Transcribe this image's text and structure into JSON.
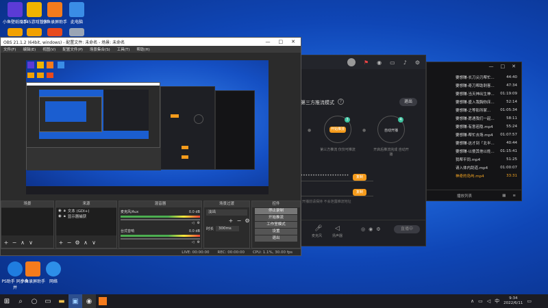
{
  "desktop": {
    "icons": [
      {
        "label": "小鱼壁纸助手",
        "color": "#5b3bd6"
      },
      {
        "label": "2345游戏管家",
        "color": "#f0b400"
      },
      {
        "label": "小鱼录屏助手",
        "color": "#f57b1c"
      },
      {
        "label": "此电脑",
        "color": "#3a8de6"
      },
      {
        "label": "",
        "color": "#f2a100"
      },
      {
        "label": "",
        "color": "#f2a100"
      },
      {
        "label": "",
        "color": "#e84a1c"
      },
      {
        "label": "",
        "color": "#9aa5b5"
      },
      {
        "label": "PS助手 同步合并",
        "color": "#1f7de0"
      },
      {
        "label": "小鱼录屏助手",
        "color": "#f57b1c"
      },
      {
        "label": "网络",
        "color": "#2d8fe8"
      }
    ]
  },
  "obs": {
    "title": "OBS 21.1.2 (64bit, windows) - 配置文件: 未命名 - 场景: 未命名",
    "menu": [
      "文件(F)",
      "编辑(E)",
      "视图(V)",
      "配置文件(P)",
      "场景集合(S)",
      "工具(T)",
      "帮助(H)"
    ],
    "panels": {
      "scenes": "场景",
      "sources": "来源",
      "mixer": "混音器",
      "transitions": "场景过渡",
      "controls": "控件"
    },
    "sources": [
      "文本 (GDI+)",
      "显示器捕获"
    ],
    "mixer": [
      {
        "name": "麦克风/Aux",
        "value": "0.0 dB"
      },
      {
        "name": "台式音响",
        "value": "0.0 dB"
      }
    ],
    "transition": {
      "value": "淡出",
      "duration_label": "时长",
      "duration": "300ms"
    },
    "controls": [
      "停止录制",
      "开始推流",
      "工作室模式",
      "设置",
      "退出"
    ],
    "status": {
      "live": "LIVE: 00:00:00",
      "rec": "REC: 00:00:00",
      "cpu": "CPU: 1.1%, 30.00 fps"
    }
  },
  "stream": {
    "mode_title": "第三方推流模式",
    "exit_label": "退出",
    "start_label": "开始推流",
    "start_desc": "第三方推流 仅仅可推流",
    "auto_label": "自动开播",
    "auto_desc": "开启后推流完成 自动开播",
    "url_mask": "•••••••••••••••••••••",
    "copy_label": "复制",
    "notice": "开播前请保持 不会泄露推流地址",
    "toolbar": [
      "麦克风",
      "扬声器"
    ],
    "golive": "直播中"
  },
  "files": {
    "items": [
      {
        "name": "要想赚-长刀尖刃帮忙...",
        "dur": "44:40"
      },
      {
        "name": "要想赚-奇刀帮助刺客...",
        "dur": "47:34"
      },
      {
        "name": "要想赚-当天神出生神...",
        "dur": "01:19:09"
      },
      {
        "name": "要想赚-盛入我胸你床...",
        "dur": "52:14"
      },
      {
        "name": "要想赚-之等影所冢...",
        "dur": "01:05:34"
      },
      {
        "name": "要想赚-愿遇我们一起...",
        "dur": "58:11"
      },
      {
        "name": "要想赚-有意若隐.mp4",
        "dur": "55:24"
      },
      {
        "name": "要想赚-帮忙去场.mp4",
        "dur": "01:07:57"
      },
      {
        "name": "要想赚-这才到「北半...",
        "dur": "40:44"
      },
      {
        "name": "要想赚-以傻其他以姓...",
        "dur": "01:15:41"
      },
      {
        "name": "我帮平同.mp4",
        "dur": "51:25"
      },
      {
        "name": "请入体内刮道.mp4",
        "dur": "01:00:07"
      },
      {
        "name": "神奇的岛屿.mp4",
        "dur": "33:31"
      }
    ],
    "footer": "播放列表"
  },
  "taskbar": {
    "time": "9:34",
    "date": "2022/6/11"
  }
}
